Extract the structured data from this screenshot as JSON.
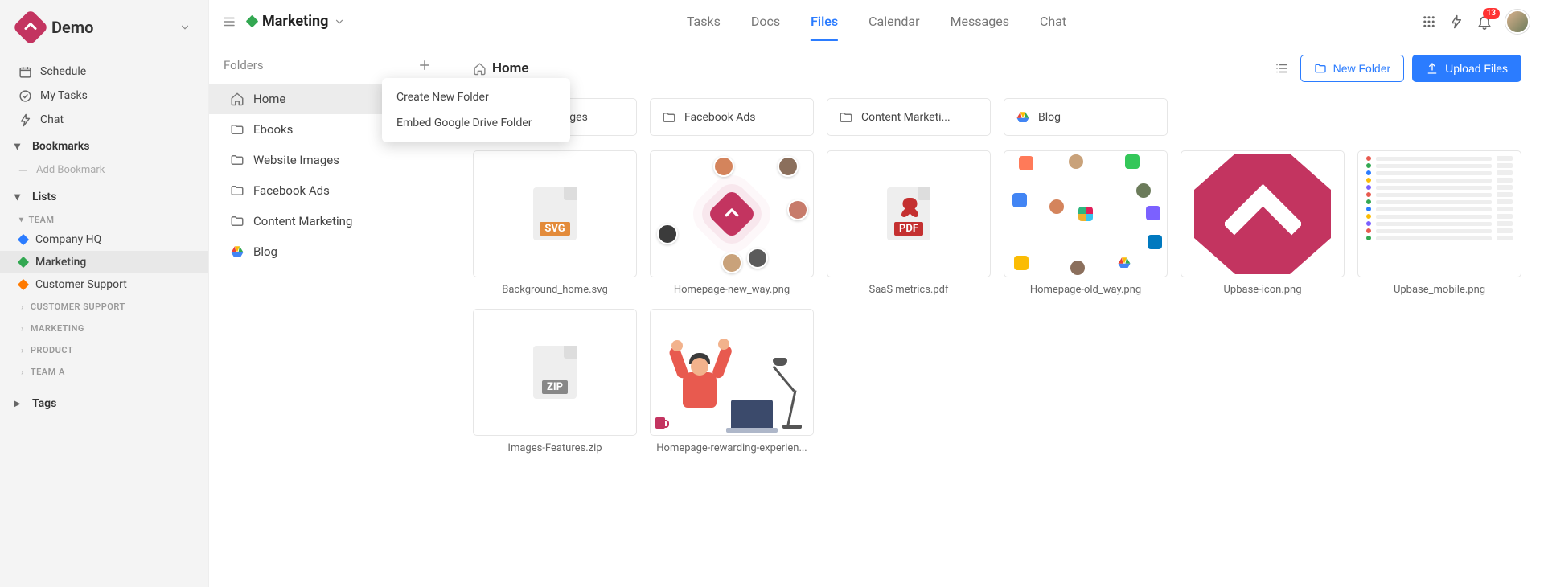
{
  "brand": {
    "name": "Demo"
  },
  "sidebar": {
    "schedule": "Schedule",
    "mytasks": "My Tasks",
    "chat": "Chat",
    "bookmarks_header": "Bookmarks",
    "add_bookmark": "Add Bookmark",
    "lists_header": "Lists",
    "team_label": "TEAM",
    "team_items": [
      {
        "label": "Company HQ",
        "color": "#2b7cff"
      },
      {
        "label": "Marketing",
        "color": "#33a852"
      },
      {
        "label": "Customer Support",
        "color": "#ff7a00"
      }
    ],
    "groups": [
      "CUSTOMER SUPPORT",
      "MARKETING",
      "PRODUCT",
      "TEAM A"
    ],
    "tags_header": "Tags"
  },
  "topbar": {
    "project": "Marketing",
    "project_color": "#33a852",
    "tabs": [
      "Tasks",
      "Docs",
      "Files",
      "Calendar",
      "Messages",
      "Chat"
    ],
    "active_tab": "Files",
    "notif_count": "13"
  },
  "folder_panel": {
    "header": "Folders",
    "items": [
      {
        "label": "Home",
        "icon": "home",
        "active": true
      },
      {
        "label": "Ebooks",
        "icon": "folder"
      },
      {
        "label": "Website Images",
        "icon": "folder"
      },
      {
        "label": "Facebook Ads",
        "icon": "folder"
      },
      {
        "label": "Content Marketing",
        "icon": "folder"
      },
      {
        "label": "Blog",
        "icon": "gdrive"
      }
    ]
  },
  "context_menu": {
    "items": [
      "Create New Folder",
      "Embed Google Drive Folder"
    ]
  },
  "files_head": {
    "breadcrumb": "Home",
    "new_folder": "New Folder",
    "upload": "Upload Files"
  },
  "folder_cards": [
    {
      "label": "Website Images",
      "icon": "folder"
    },
    {
      "label": "Facebook Ads",
      "icon": "folder"
    },
    {
      "label": "Content Marketi...",
      "icon": "folder"
    },
    {
      "label": "Blog",
      "icon": "gdrive"
    }
  ],
  "files": [
    {
      "name": "Background_home.svg",
      "thumb": "svg"
    },
    {
      "name": "Homepage-new_way.png",
      "thumb": "radial"
    },
    {
      "name": "SaaS metrics.pdf",
      "thumb": "pdf"
    },
    {
      "name": "Homepage-old_way.png",
      "thumb": "integrations"
    },
    {
      "name": "Upbase-icon.png",
      "thumb": "upbase"
    },
    {
      "name": "Upbase_mobile.png",
      "thumb": "mobile"
    },
    {
      "name": "Images-Features.zip",
      "thumb": "zip"
    },
    {
      "name": "Homepage-rewarding-experien...",
      "thumb": "rewarding"
    }
  ],
  "filetype_labels": {
    "svg": "SVG",
    "pdf": "PDF",
    "zip": "ZIP"
  },
  "mobile_dots": [
    "#e85a4f",
    "#33a852",
    "#2b7cff",
    "#fbbc04",
    "#7b61ff",
    "#e85a4f",
    "#33a852",
    "#2b7cff",
    "#fbbc04",
    "#7b61ff",
    "#e85a4f",
    "#33a852"
  ]
}
